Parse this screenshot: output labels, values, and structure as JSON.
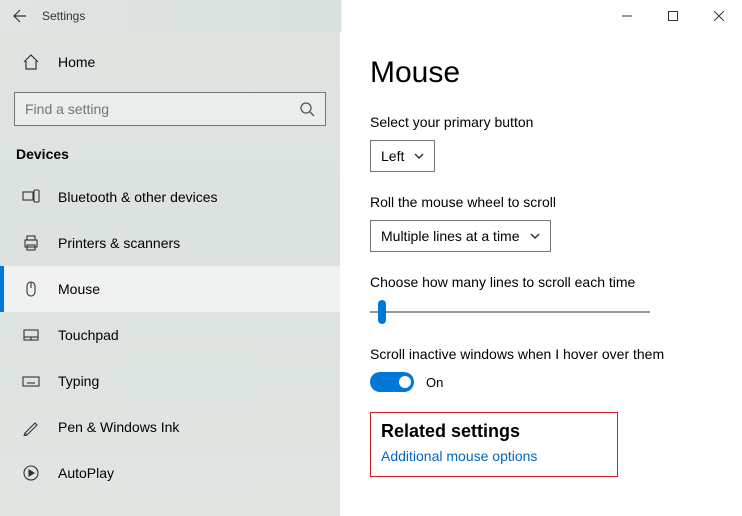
{
  "titlebar": {
    "title": "Settings"
  },
  "sidebar": {
    "home_label": "Home",
    "search_placeholder": "Find a setting",
    "section_title": "Devices",
    "items": [
      {
        "label": "Bluetooth & other devices"
      },
      {
        "label": "Printers & scanners"
      },
      {
        "label": "Mouse"
      },
      {
        "label": "Touchpad"
      },
      {
        "label": "Typing"
      },
      {
        "label": "Pen & Windows Ink"
      },
      {
        "label": "AutoPlay"
      }
    ]
  },
  "content": {
    "heading": "Mouse",
    "primary_button_label": "Select your primary button",
    "primary_button_value": "Left",
    "scroll_wheel_label": "Roll the mouse wheel to scroll",
    "scroll_wheel_value": "Multiple lines at a time",
    "lines_label": "Choose how many lines to scroll each time",
    "inactive_label": "Scroll inactive windows when I hover over them",
    "inactive_value": "On",
    "related_heading": "Related settings",
    "related_link": "Additional mouse options"
  }
}
